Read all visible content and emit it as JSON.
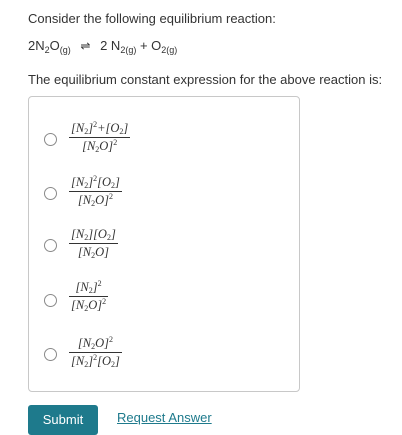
{
  "prompt": "Consider the following equilibrium reaction:",
  "reaction": {
    "coef1": "2N",
    "sub1": "2",
    "species1_rest": "O",
    "phase1": "(g)",
    "arrow": "⇌",
    "coef2": "2 N",
    "phase2": "2(g)",
    "plus": " + O",
    "phase3": "2(g)"
  },
  "question": "The equilibrium constant expression for the above reaction is:",
  "options": [
    {
      "num": "[N₂]²+[O₂]",
      "den": "[N₂O]²"
    },
    {
      "num": "[N₂]²[O₂]",
      "den": "[N₂O]²"
    },
    {
      "num": "[N₂][O₂]",
      "den": "[N₂O]"
    },
    {
      "num": "[N₂]²",
      "den": "[N₂O]²"
    },
    {
      "num": "[N₂O]²",
      "den": "[N₂]²[O₂]"
    }
  ],
  "submit_label": "Submit",
  "request_label": "Request Answer",
  "colors": {
    "accent": "#1e7a8c",
    "text": "#333333",
    "border": "#c8c8c8"
  }
}
